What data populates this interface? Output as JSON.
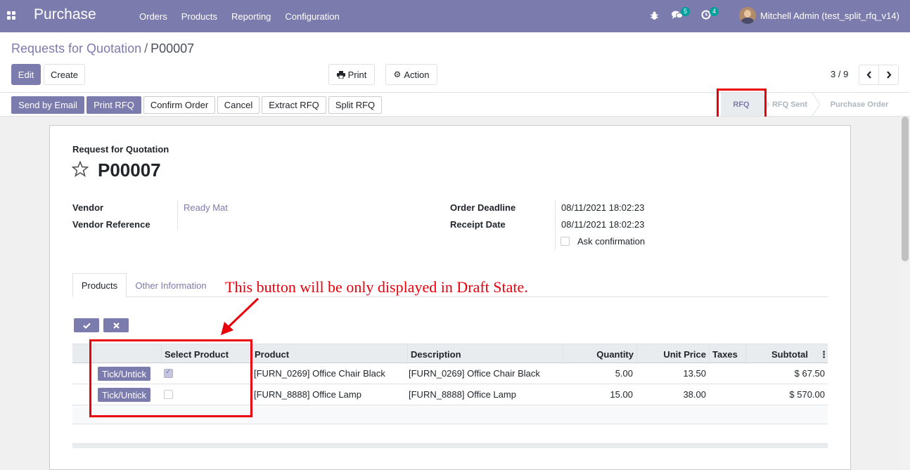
{
  "navbar": {
    "app_name": "Purchase",
    "menu": [
      "Orders",
      "Products",
      "Reporting",
      "Configuration"
    ],
    "messages_count": "5",
    "activities_count": "4",
    "user": "Mitchell Admin (test_split_rfq_v14)"
  },
  "breadcrumb": {
    "parent": "Requests for Quotation",
    "separator": "/",
    "current": "P00007"
  },
  "controls": {
    "edit": "Edit",
    "create": "Create",
    "print": "Print",
    "action": "Action",
    "pager": "3 / 9"
  },
  "header_buttons": [
    "Send by Email",
    "Print RFQ",
    "Confirm Order",
    "Cancel",
    "Extract RFQ",
    "Split RFQ"
  ],
  "stages": {
    "rfq": "RFQ",
    "rfq_sent": "RFQ Sent",
    "purchase_order": "Purchase Order",
    "active": "RFQ"
  },
  "form": {
    "doc_type": "Request for Quotation",
    "name": "P00007",
    "vendor_label": "Vendor",
    "vendor_value": "Ready Mat",
    "vendor_ref_label": "Vendor Reference",
    "order_deadline_label": "Order Deadline",
    "order_deadline_value": "08/11/2021 18:02:23",
    "receipt_date_label": "Receipt Date",
    "receipt_date_value": "08/11/2021 18:02:23",
    "ask_confirmation_label": "Ask confirmation"
  },
  "tabs": {
    "products": "Products",
    "other": "Other Information"
  },
  "annotation": "This button will be only displayed in Draft State.",
  "table": {
    "headers": {
      "select": "Select Product",
      "product": "Product",
      "description": "Description",
      "quantity": "Quantity",
      "unit_price": "Unit Price",
      "taxes": "Taxes",
      "subtotal": "Subtotal"
    },
    "tick_label": "Tick/Untick",
    "rows": [
      {
        "product": "[FURN_0269] Office Chair Black",
        "description": "[FURN_0269] Office Chair Black",
        "quantity": "5.00",
        "unit_price": "13.50",
        "taxes": "",
        "subtotal": "$ 67.50",
        "selected": true
      },
      {
        "product": "[FURN_8888] Office Lamp",
        "description": "[FURN_8888] Office Lamp",
        "quantity": "15.00",
        "unit_price": "38.00",
        "taxes": "",
        "subtotal": "$ 570.00",
        "selected": false
      }
    ]
  },
  "colors": {
    "brand": "#7c7bad",
    "annotation": "#e8000b"
  }
}
